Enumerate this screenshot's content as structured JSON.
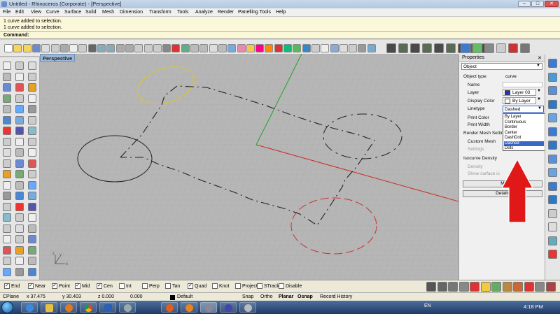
{
  "window": {
    "title": "Untitled - Rhinoceros (Corporate) - [Perspective]"
  },
  "menu": [
    "File",
    "Edit",
    "View",
    "Curve",
    "Surface",
    "Solid",
    "Mesh",
    "Dimension",
    "Transform",
    "Tools",
    "Analyze",
    "Render",
    "Panelling Tools",
    "Help"
  ],
  "history": {
    "line1": "1 curve added to selection.",
    "line2": "1 curve added to selection."
  },
  "command": {
    "label": "Command:"
  },
  "viewport": {
    "label": "Perspective"
  },
  "properties": {
    "title": "Properties",
    "object_filter": "Object",
    "object_type_label": "Object type",
    "object_type_value": "curve",
    "name_label": "Name",
    "layer_label": "Layer",
    "layer_value": "Layer 03",
    "layer_color": "#1f2fd0",
    "display_color_label": "Display Color",
    "display_color_value": "By Layer",
    "linetype_label": "Linetype",
    "linetype_value": "Dashed",
    "print_color_label": "Print Color",
    "print_width_label": "Print Width",
    "render_mesh_label": "Render Mesh Settin",
    "custom_mesh_label": "Custom Mesh",
    "settings_label": "Settings",
    "isocurve_label": "Isocurve Density",
    "density_label": "Density",
    "show_surface_label": "Show surface is",
    "match_label": "M",
    "details_label": "Details",
    "linetype_options": [
      "By Layer",
      "Continuous",
      "Border",
      "Center",
      "DashDot",
      "Dashed",
      "Dots"
    ],
    "selected_option": "Dashed"
  },
  "osnaps": [
    {
      "label": "End",
      "checked": true
    },
    {
      "label": "Near",
      "checked": true
    },
    {
      "label": "Point",
      "checked": true
    },
    {
      "label": "Mid",
      "checked": true
    },
    {
      "label": "Cen",
      "checked": true
    },
    {
      "label": "Int",
      "checked": false
    },
    {
      "label": "Perp",
      "checked": false
    },
    {
      "label": "Tan",
      "checked": false
    },
    {
      "label": "Quad",
      "checked": true
    },
    {
      "label": "Knot",
      "checked": false
    },
    {
      "label": "Project",
      "checked": false
    },
    {
      "label": "STrack",
      "checked": false
    },
    {
      "label": "Disable",
      "checked": false
    }
  ],
  "status": {
    "cplane": "CPlane",
    "x": "x 37.475",
    "y": "y 30.403",
    "z": "z 0.000",
    "extra": "0.000",
    "layer": "Default",
    "snap": "Snap",
    "ortho": "Ortho",
    "planar": "Planar",
    "osnap": "Osnap",
    "record": "Record History"
  },
  "taskbar": {
    "lang": "EN",
    "time": "4:18 PM"
  },
  "annotations": {
    "arrow_color": "#e01818"
  }
}
